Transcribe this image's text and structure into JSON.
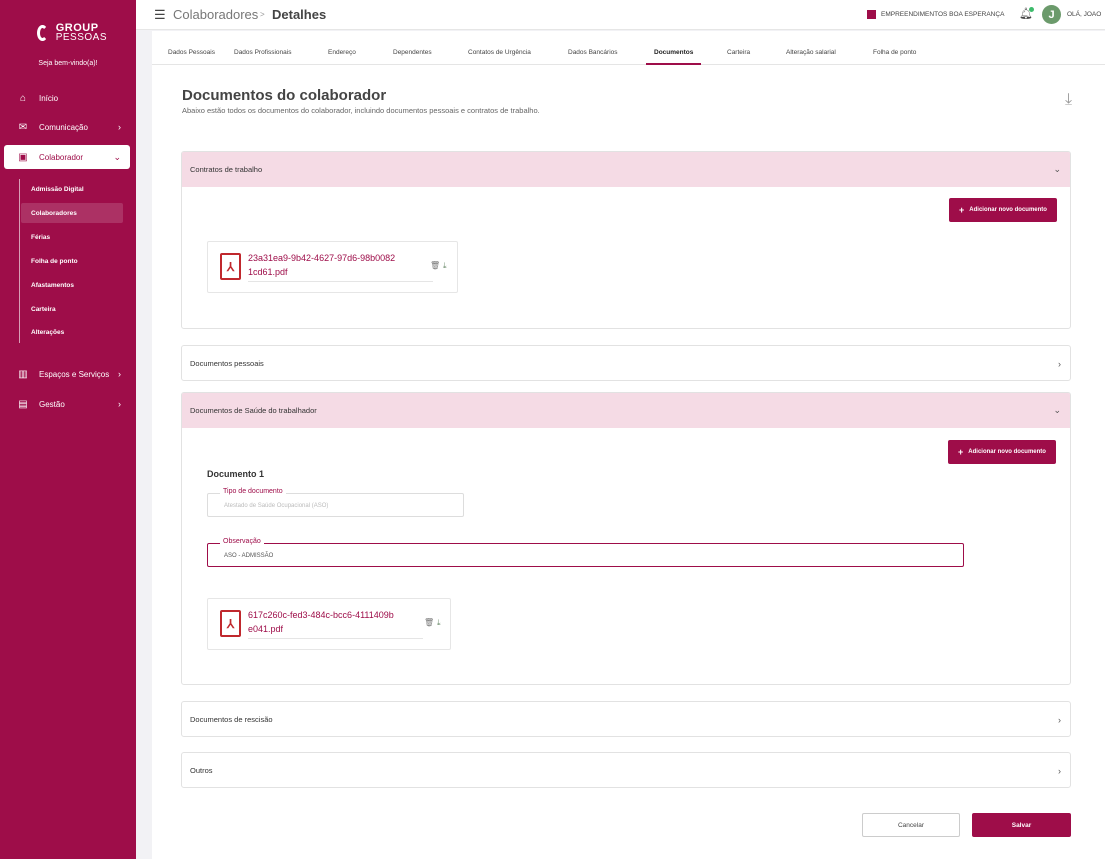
{
  "brand": {
    "line1": "GROUP",
    "line2": "PESSOAS"
  },
  "sidebar": {
    "welcome": "Seja bem-vindo(a)!",
    "items": [
      {
        "label": "Início",
        "icon": "home-icon"
      },
      {
        "label": "Comunicação",
        "icon": "chat-icon"
      },
      {
        "label": "Colaborador",
        "icon": "id-card-icon"
      },
      {
        "label": "Espaços e Serviços",
        "icon": "building-icon"
      },
      {
        "label": "Gestão",
        "icon": "briefcase-icon"
      }
    ],
    "subitems": [
      "Admissão Digital",
      "Colaboradores",
      "Férias",
      "Folha de ponto",
      "Afastamentos",
      "Carteira",
      "Alterações"
    ]
  },
  "header": {
    "breadcrumb_parent": "Colaboradores",
    "breadcrumb_sep": ">",
    "breadcrumb_current": "Detalhes",
    "company": "EMPREENDIMENTOS BOA ESPERANÇA",
    "avatar_initial": "J",
    "greeting": "OLÁ, JOAO"
  },
  "tabs": [
    "Dados Pessoais",
    "Dados Profissionais",
    "Endereço",
    "Dependentes",
    "Contatos de Urgência",
    "Dados Bancários",
    "Documentos",
    "Carteira",
    "Alteração salarial",
    "Folha de ponto"
  ],
  "active_tab": "Documentos",
  "page": {
    "title": "Documentos do colaborador",
    "subtitle": "Abaixo estão todos os documentos do colaborador, incluindo documentos pessoais e contratos de trabalho."
  },
  "sections": {
    "contratos": {
      "title": "Contratos de trabalho",
      "add_label": "Adicionar novo documento",
      "file_name": "23a31ea9-9b42-4627-97d6-98b00821cd61.pdf"
    },
    "pessoais": {
      "title": "Documentos pessoais"
    },
    "saude": {
      "title": "Documentos de Saúde do trabalhador",
      "add_label": "Adicionar novo documento",
      "doc_label": "Documento 1",
      "tipo_legend": "Tipo de documento",
      "tipo_value": "Atestado de Saúde Ocupacional (ASO)",
      "obs_legend": "Observação",
      "obs_value": "ASO - ADMISSÃO",
      "file_name": "617c260c-fed3-484c-bcc6-4111409be041.pdf"
    },
    "rescisao": {
      "title": "Documentos de rescisão"
    },
    "outros": {
      "title": "Outros"
    }
  },
  "actions": {
    "cancel": "Cancelar",
    "save": "Salvar"
  },
  "colors": {
    "primary": "#9e0d49",
    "section_open_bg": "#f5dbe5"
  }
}
